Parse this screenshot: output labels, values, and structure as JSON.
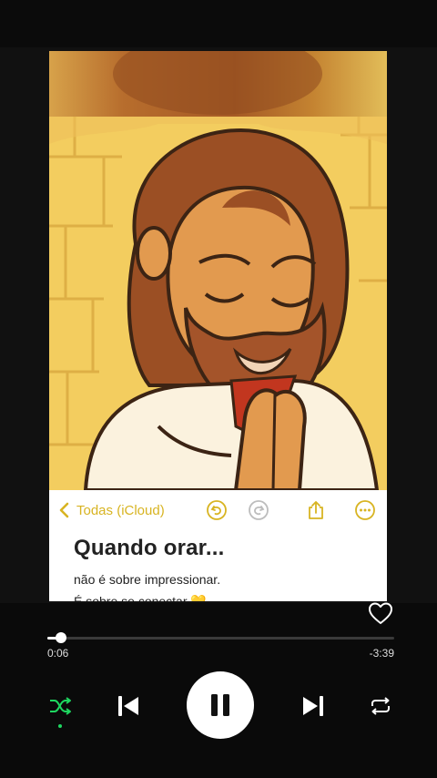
{
  "note": {
    "back_label": "Todas (iCloud)",
    "title": "Quando orar...",
    "line1": "não é sobre impressionar.",
    "line2": "É sobre se conectar 💛"
  },
  "player": {
    "elapsed": "0:06",
    "remaining": "-3:39",
    "progress_fraction": 0.04,
    "liked": false,
    "is_playing": true,
    "shuffle_active": true
  },
  "colors": {
    "notes_accent": "#d8b422",
    "shuffle_active": "#1ed760",
    "background": "#0a0a0a"
  },
  "icons": {
    "back": "chevron-left-icon",
    "undo": "undo-icon",
    "redo": "redo-icon",
    "share": "share-icon",
    "more": "more-icon",
    "like": "heart-icon",
    "shuffle": "shuffle-icon",
    "previous": "skip-previous-icon",
    "pause": "pause-icon",
    "next": "skip-next-icon",
    "repeat": "repeat-icon"
  }
}
